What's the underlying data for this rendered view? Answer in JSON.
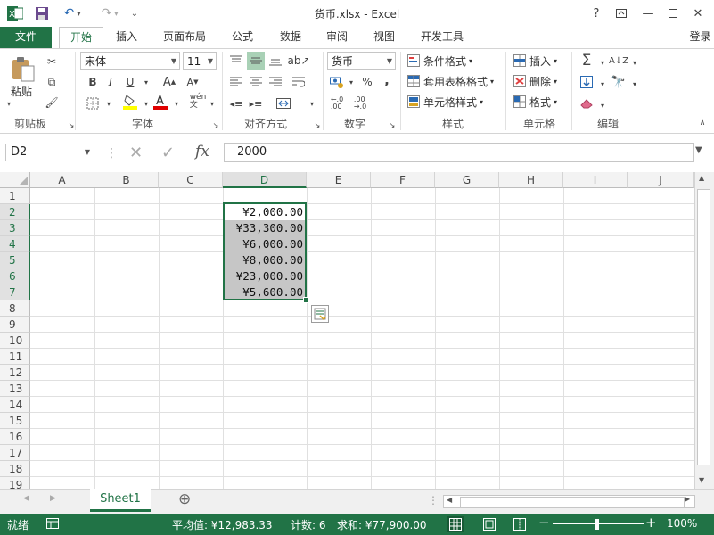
{
  "window": {
    "title": "货币.xlsx - Excel",
    "help": "?",
    "signin": "登录"
  },
  "tabs": [
    "文件",
    "开始",
    "插入",
    "页面布局",
    "公式",
    "数据",
    "审阅",
    "视图",
    "开发工具"
  ],
  "ribbon": {
    "clipboard": {
      "label": "剪贴板",
      "paste": "粘贴"
    },
    "font": {
      "label": "字体",
      "name": "宋体",
      "size": "11",
      "bold": "B",
      "italic": "I",
      "underline": "U"
    },
    "alignment": {
      "label": "对齐方式"
    },
    "number": {
      "label": "数字",
      "format": "货币",
      "percent": "%",
      "comma": ","
    },
    "styles": {
      "label": "样式",
      "conditional": "条件格式",
      "table": "套用表格格式",
      "cell": "单元格样式"
    },
    "cells": {
      "label": "单元格",
      "insert": "插入",
      "delete": "删除",
      "format": "格式"
    },
    "editing": {
      "label": "编辑"
    }
  },
  "formula_bar": {
    "name_box": "D2",
    "value": "2000",
    "fx": "fx"
  },
  "columns": [
    "A",
    "B",
    "C",
    "D",
    "E",
    "F",
    "G",
    "H",
    "I",
    "J"
  ],
  "rows": [
    "1",
    "2",
    "3",
    "4",
    "5",
    "6",
    "7",
    "8",
    "9",
    "10",
    "11",
    "12",
    "13",
    "14",
    "15",
    "16",
    "17",
    "18",
    "19"
  ],
  "cells_d": [
    "¥2,000.00",
    "¥33,300.00",
    "¥6,000.00",
    "¥8,000.00",
    "¥23,000.00",
    "¥5,600.00"
  ],
  "sheet": {
    "name": "Sheet1",
    "add": "⊕"
  },
  "status": {
    "mode": "就绪",
    "average": "平均值: ¥12,983.33",
    "count": "计数: 6",
    "sum": "求和: ¥77,900.00",
    "zoom": "100%"
  },
  "colors": {
    "accent": "#217346",
    "selection": "#c6c6c6"
  }
}
